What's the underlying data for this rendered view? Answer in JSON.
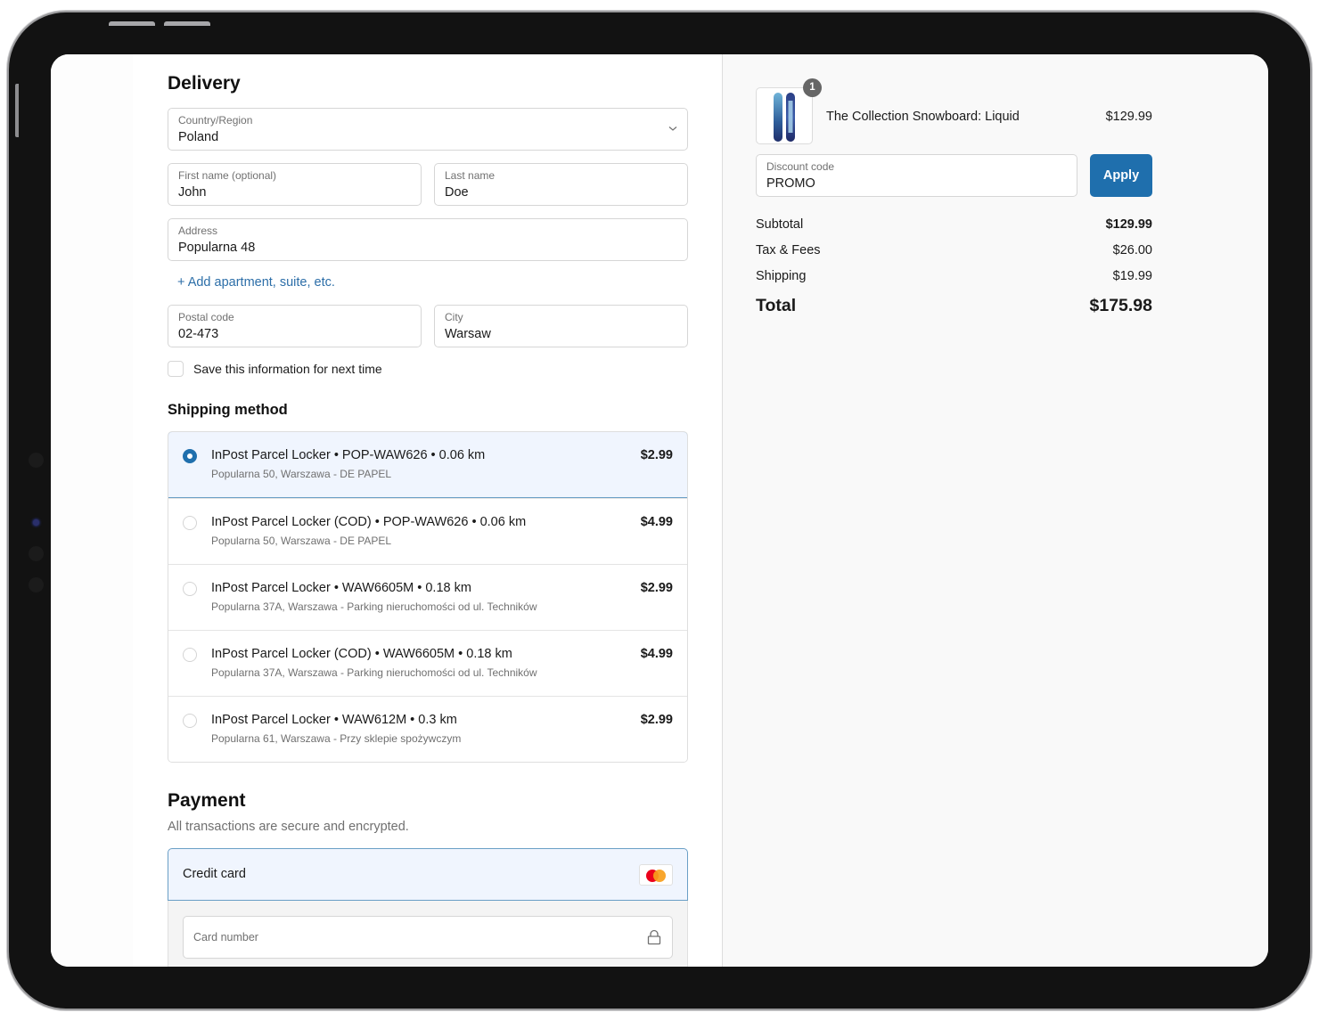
{
  "delivery": {
    "title": "Delivery",
    "country": {
      "label": "Country/Region",
      "value": "Poland"
    },
    "first_name": {
      "label": "First name (optional)",
      "value": "John"
    },
    "last_name": {
      "label": "Last name",
      "value": "Doe"
    },
    "address": {
      "label": "Address",
      "value": "Popularna 48"
    },
    "add_apartment_link": "+ Add apartment, suite, etc.",
    "postal_code": {
      "label": "Postal code",
      "value": "02-473"
    },
    "city": {
      "label": "City",
      "value": "Warsaw"
    },
    "save_info": {
      "label": "Save this information for next time",
      "checked": false
    }
  },
  "shipping": {
    "title": "Shipping method",
    "selected_index": 0,
    "options": [
      {
        "name": "InPost Parcel Locker • POP-WAW626 • 0.06 km",
        "address": "Popularna 50, Warszawa - DE PAPEL",
        "price": "$2.99"
      },
      {
        "name": "InPost Parcel Locker (COD) • POP-WAW626 • 0.06 km",
        "address": "Popularna 50, Warszawa - DE PAPEL",
        "price": "$4.99"
      },
      {
        "name": "InPost Parcel Locker • WAW6605M • 0.18 km",
        "address": "Popularna 37A, Warszawa - Parking nieruchomości od ul. Techników",
        "price": "$2.99"
      },
      {
        "name": "InPost Parcel Locker (COD) • WAW6605M • 0.18 km",
        "address": "Popularna 37A, Warszawa - Parking nieruchomości od ul. Techników",
        "price": "$4.99"
      },
      {
        "name": "InPost Parcel Locker • WAW612M • 0.3 km",
        "address": "Popularna 61, Warszawa - Przy sklepie spożywczym",
        "price": "$2.99"
      }
    ]
  },
  "payment": {
    "title": "Payment",
    "subtitle": "All transactions are secure and encrypted.",
    "method": "Credit card",
    "card_brand_icon": "mastercard-icon",
    "card_number_placeholder": "Card number"
  },
  "summary": {
    "product": {
      "name": "The Collection Snowboard: Liquid",
      "price": "$129.99",
      "quantity": "1"
    },
    "discount": {
      "label": "Discount code",
      "value": "PROMO",
      "apply_label": "Apply"
    },
    "subtotal": {
      "label": "Subtotal",
      "value": "$129.99"
    },
    "tax": {
      "label": "Tax & Fees",
      "value": "$26.00"
    },
    "shipping": {
      "label": "Shipping",
      "value": "$19.99"
    },
    "total": {
      "label": "Total",
      "value": "$175.98"
    }
  },
  "colors": {
    "accent": "#1f6fad",
    "selected_bg": "#f0f5fe",
    "summary_bg": "#f9f9f9",
    "link": "#2c6ea8"
  }
}
